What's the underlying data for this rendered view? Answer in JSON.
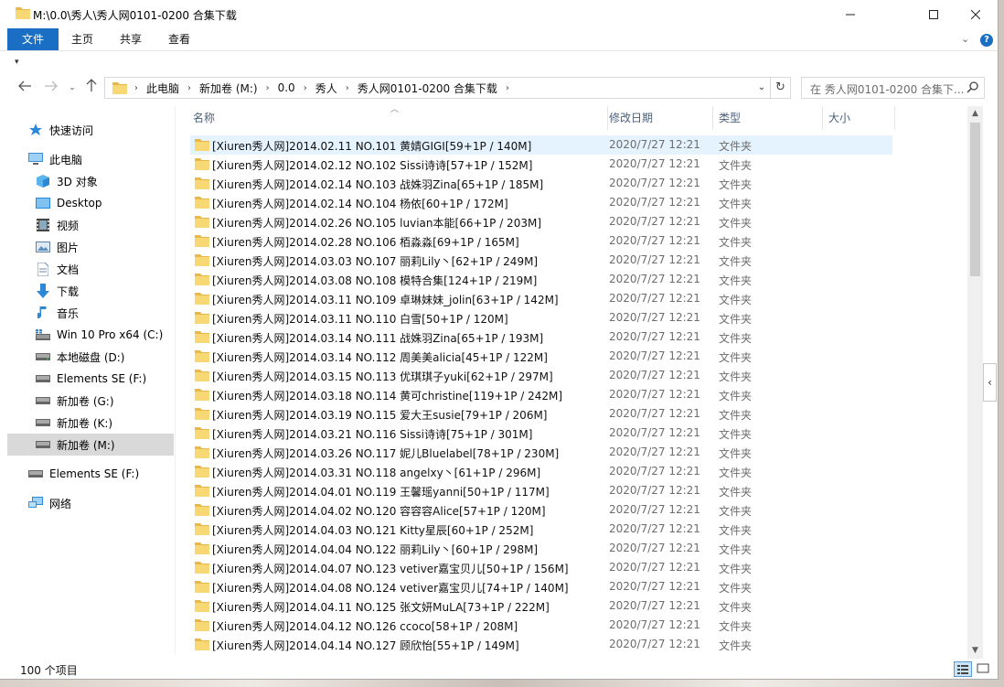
{
  "window": {
    "title": "M:\\0.0\\秀人\\秀人网0101-0200 合集下载",
    "controls": [
      "minimize-icon",
      "maximize-icon",
      "close-icon"
    ]
  },
  "ribbon": {
    "tabs": [
      "文件",
      "主页",
      "共享",
      "查看"
    ],
    "active_tab": "文件",
    "accent": "#1a6fc4"
  },
  "address": {
    "crumbs": [
      "此电脑",
      "新加卷 (M:)",
      "0.0",
      "秀人",
      "秀人网0101-0200 合集下载"
    ]
  },
  "search": {
    "placeholder": "在 秀人网0101-0200 合集下..."
  },
  "sidebar": {
    "items": [
      {
        "label": "快速访问",
        "icon": "star-icon"
      },
      {
        "label": "此电脑",
        "icon": "computer-icon"
      },
      {
        "label": "3D 对象",
        "icon": "3d-objects-icon"
      },
      {
        "label": "Desktop",
        "icon": "desktop-icon"
      },
      {
        "label": "视频",
        "icon": "video-icon"
      },
      {
        "label": "图片",
        "icon": "pictures-icon"
      },
      {
        "label": "文档",
        "icon": "documents-icon"
      },
      {
        "label": "下载",
        "icon": "download-icon"
      },
      {
        "label": "音乐",
        "icon": "music-icon"
      },
      {
        "label": "Win 10 Pro x64 (C:)",
        "icon": "windows-drive-icon"
      },
      {
        "label": "本地磁盘 (D:)",
        "icon": "drive-icon"
      },
      {
        "label": "Elements SE (F:)",
        "icon": "drive-icon"
      },
      {
        "label": "新加卷 (G:)",
        "icon": "drive-icon"
      },
      {
        "label": "新加卷 (K:)",
        "icon": "drive-icon"
      },
      {
        "label": "新加卷 (M:)",
        "icon": "drive-icon",
        "selected": true
      },
      {
        "label": "Elements SE (F:)",
        "icon": "drive-icon"
      },
      {
        "label": "网络",
        "icon": "network-icon"
      }
    ]
  },
  "columns": {
    "name": "名称",
    "date": "修改日期",
    "type": "类型",
    "size": "大小"
  },
  "files": [
    {
      "name": "[Xiuren秀人网]2014.02.11 NO.101 黄婧GIGI[59+1P / 140M]",
      "date": "2020/7/27 12:21",
      "type": "文件夹"
    },
    {
      "name": "[Xiuren秀人网]2014.02.12 NO.102 Sissi诗诗[57+1P / 152M]",
      "date": "2020/7/27 12:21",
      "type": "文件夹"
    },
    {
      "name": "[Xiuren秀人网]2014.02.14 NO.103 战姝羽Zina[65+1P / 185M]",
      "date": "2020/7/27 12:21",
      "type": "文件夹"
    },
    {
      "name": "[Xiuren秀人网]2014.02.14 NO.104 杨依[60+1P / 172M]",
      "date": "2020/7/27 12:21",
      "type": "文件夹"
    },
    {
      "name": "[Xiuren秀人网]2014.02.26 NO.105 luvian本能[66+1P / 203M]",
      "date": "2020/7/27 12:21",
      "type": "文件夹"
    },
    {
      "name": "[Xiuren秀人网]2014.02.28 NO.106 栢淼淼[69+1P / 165M]",
      "date": "2020/7/27 12:21",
      "type": "文件夹"
    },
    {
      "name": "[Xiuren秀人网]2014.03.03 NO.107 丽莉Lily丶[62+1P / 249M]",
      "date": "2020/7/27 12:21",
      "type": "文件夹"
    },
    {
      "name": "[Xiuren秀人网]2014.03.08 NO.108 模特合集[124+1P / 219M]",
      "date": "2020/7/27 12:21",
      "type": "文件夹"
    },
    {
      "name": "[Xiuren秀人网]2014.03.11 NO.109 卓琳妹妹_jolin[63+1P / 142M]",
      "date": "2020/7/27 12:21",
      "type": "文件夹"
    },
    {
      "name": "[Xiuren秀人网]2014.03.11 NO.110 白雪[50+1P / 120M]",
      "date": "2020/7/27 12:21",
      "type": "文件夹"
    },
    {
      "name": "[Xiuren秀人网]2014.03.14 NO.111 战姝羽Zina[65+1P / 193M]",
      "date": "2020/7/27 12:21",
      "type": "文件夹"
    },
    {
      "name": "[Xiuren秀人网]2014.03.14 NO.112 周美美alicia[45+1P / 122M]",
      "date": "2020/7/27 12:21",
      "type": "文件夹"
    },
    {
      "name": "[Xiuren秀人网]2014.03.15 NO.113 优琪琪子yuki[62+1P / 297M]",
      "date": "2020/7/27 12:21",
      "type": "文件夹"
    },
    {
      "name": "[Xiuren秀人网]2014.03.18 NO.114 黄可christine[119+1P / 242M]",
      "date": "2020/7/27 12:21",
      "type": "文件夹"
    },
    {
      "name": "[Xiuren秀人网]2014.03.19 NO.115 爱大王susie[79+1P / 206M]",
      "date": "2020/7/27 12:21",
      "type": "文件夹"
    },
    {
      "name": "[Xiuren秀人网]2014.03.21 NO.116 Sissi诗诗[75+1P / 301M]",
      "date": "2020/7/27 12:21",
      "type": "文件夹"
    },
    {
      "name": "[Xiuren秀人网]2014.03.26 NO.117 妮儿Bluelabel[78+1P / 230M]",
      "date": "2020/7/27 12:21",
      "type": "文件夹"
    },
    {
      "name": "[Xiuren秀人网]2014.03.31 NO.118 angelxy丶[61+1P / 296M]",
      "date": "2020/7/27 12:21",
      "type": "文件夹"
    },
    {
      "name": "[Xiuren秀人网]2014.04.01 NO.119 王馨瑶yanni[50+1P / 117M]",
      "date": "2020/7/27 12:21",
      "type": "文件夹"
    },
    {
      "name": "[Xiuren秀人网]2014.04.02 NO.120 容容容Alice[57+1P / 120M]",
      "date": "2020/7/27 12:21",
      "type": "文件夹"
    },
    {
      "name": "[Xiuren秀人网]2014.04.03 NO.121 Kitty星辰[60+1P / 252M]",
      "date": "2020/7/27 12:21",
      "type": "文件夹"
    },
    {
      "name": "[Xiuren秀人网]2014.04.04 NO.122 丽莉Lily丶[60+1P / 298M]",
      "date": "2020/7/27 12:21",
      "type": "文件夹"
    },
    {
      "name": "[Xiuren秀人网]2014.04.07 NO.123 vetiver嘉宝贝儿[50+1P / 156M]",
      "date": "2020/7/27 12:21",
      "type": "文件夹"
    },
    {
      "name": "[Xiuren秀人网]2014.04.08 NO.124 vetiver嘉宝贝儿[74+1P / 140M]",
      "date": "2020/7/27 12:21",
      "type": "文件夹"
    },
    {
      "name": "[Xiuren秀人网]2014.04.11 NO.125 张文妍MuLA[73+1P / 222M]",
      "date": "2020/7/27 12:21",
      "type": "文件夹"
    },
    {
      "name": "[Xiuren秀人网]2014.04.12 NO.126 ccoco[58+1P / 208M]",
      "date": "2020/7/27 12:21",
      "type": "文件夹"
    },
    {
      "name": "[Xiuren秀人网]2014.04.14 NO.127 顾欣怡[55+1P / 149M]",
      "date": "2020/7/27 12:21",
      "type": "文件夹"
    }
  ],
  "status": {
    "item_count": "100 个项目"
  }
}
